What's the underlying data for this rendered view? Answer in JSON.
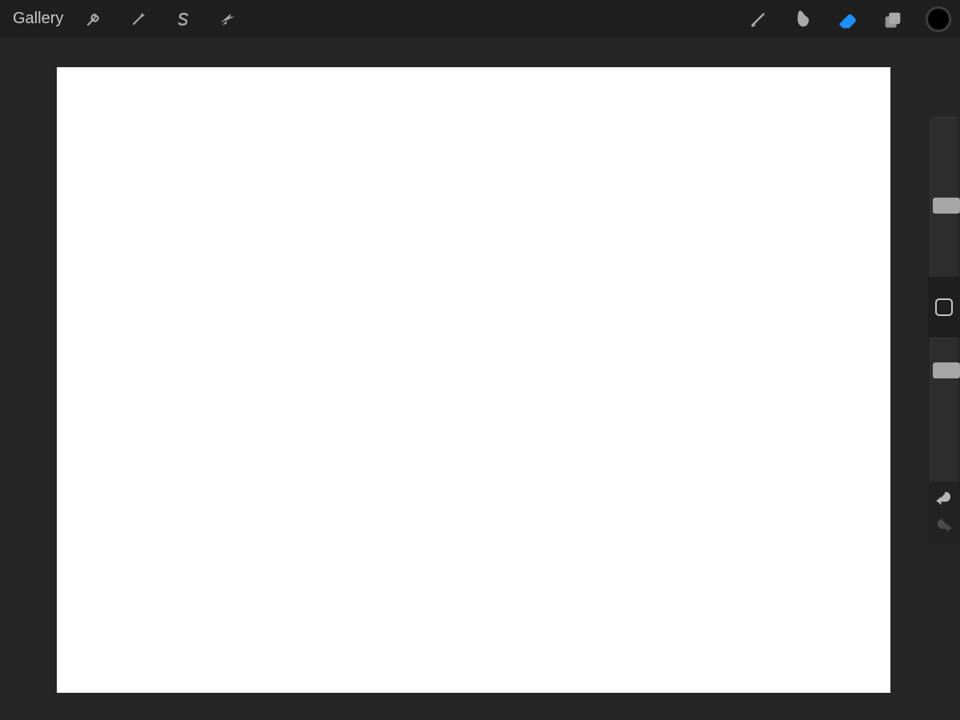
{
  "topbar": {
    "gallery_label": "Gallery",
    "left_tools": {
      "actions": "actions-wrench-icon",
      "adjust": "adjustments-wand-icon",
      "selection": "selection-s-icon",
      "transform": "transform-arrow-icon"
    },
    "right_tools": {
      "brush": {
        "name": "brush-tool-icon",
        "active": false
      },
      "smudge": {
        "name": "smudge-tool-icon",
        "active": false
      },
      "eraser": {
        "name": "eraser-tool-icon",
        "active": true
      },
      "layers": {
        "name": "layers-icon",
        "active": false
      }
    },
    "color_swatch": "#000000"
  },
  "canvas": {
    "background": "#ffffff"
  },
  "sidebar": {
    "brush_size_slider": {
      "position_pct": 50
    },
    "brush_opacity_slider": {
      "position_pct": 15
    },
    "modify_button": "square-modify-icon",
    "undo": {
      "enabled": true
    },
    "redo": {
      "enabled": false
    }
  },
  "colors": {
    "accent": "#1e8fff",
    "toolbar_bg": "#1f1f1f",
    "workspace_bg": "#262626",
    "icon_inactive": "#a9a9a9"
  }
}
